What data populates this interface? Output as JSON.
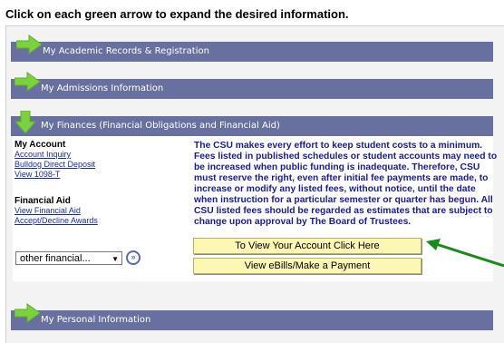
{
  "instruction": "Click on each green arrow to expand the desired information.",
  "sections": {
    "academic": "My Academic Records & Registration",
    "admissions": "My Admissions Information",
    "finances": "My Finances (Financial Obligations and Financial Aid)",
    "personal": "My Personal Information"
  },
  "my_account": {
    "heading": "My Account",
    "links": [
      "Account Inquiry",
      "Bulldog Direct Deposit",
      "View 1098-T"
    ]
  },
  "financial_aid": {
    "heading": "Financial Aid",
    "links": [
      "View Financial Aid",
      "Accept/Decline Awards"
    ]
  },
  "notice": "The CSU makes every effort to keep student costs to a minimum. Fees listed in published schedules or student accounts may need to be increased when public funding is inadequate. Therefore, CSU must reserve the right, even after initial fee payments are made, to increase or modify any listed fees, without notice, until the date when instruction for a particular semester or quarter has begun. All CSU listed fees should be regarded as estimates that are subject to change upon approval by The Board of Trustees.",
  "buttons": {
    "view_account": "To View Your Account Click Here",
    "ebills": "View eBills/Make a Payment"
  },
  "dropdown": {
    "selected": "other financial..."
  },
  "colors": {
    "section_bar": "#68709f",
    "arrow": "#7ad23c",
    "pointer_arrow": "#1a8a1a",
    "button_bg": "#fdf7b4"
  }
}
